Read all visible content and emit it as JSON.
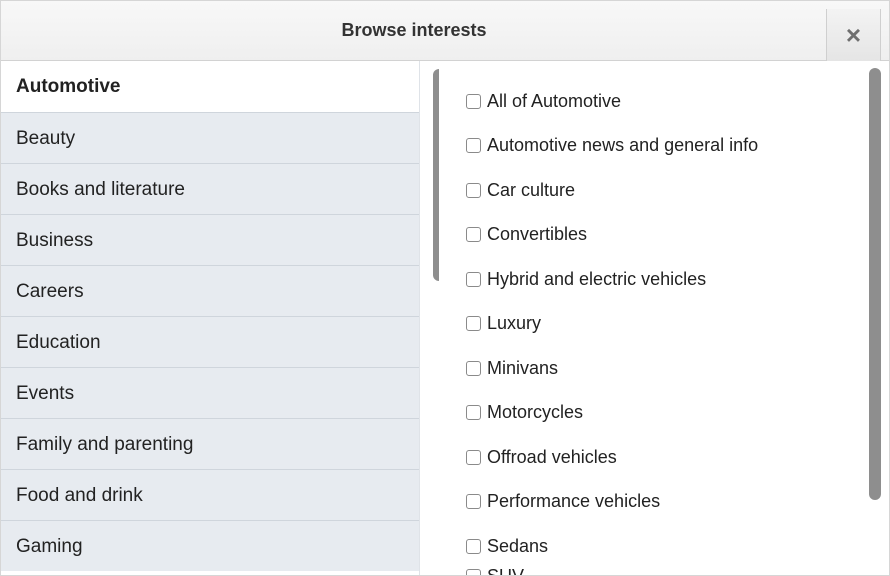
{
  "header": {
    "title": "Browse interests",
    "close_icon": "close-icon"
  },
  "categories": [
    {
      "label": "Automotive",
      "active": true
    },
    {
      "label": "Beauty",
      "active": false
    },
    {
      "label": "Books and literature",
      "active": false
    },
    {
      "label": "Business",
      "active": false
    },
    {
      "label": "Careers",
      "active": false
    },
    {
      "label": "Education",
      "active": false
    },
    {
      "label": "Events",
      "active": false
    },
    {
      "label": "Family and parenting",
      "active": false
    },
    {
      "label": "Food and drink",
      "active": false
    },
    {
      "label": "Gaming",
      "active": false
    }
  ],
  "options": [
    {
      "label": "All of Automotive",
      "checked": false
    },
    {
      "label": "Automotive news and general info",
      "checked": false
    },
    {
      "label": "Car culture",
      "checked": false
    },
    {
      "label": "Convertibles",
      "checked": false
    },
    {
      "label": "Hybrid and electric vehicles",
      "checked": false
    },
    {
      "label": "Luxury",
      "checked": false
    },
    {
      "label": "Minivans",
      "checked": false
    },
    {
      "label": "Motorcycles",
      "checked": false
    },
    {
      "label": "Offroad vehicles",
      "checked": false
    },
    {
      "label": "Performance vehicles",
      "checked": false
    },
    {
      "label": "Sedans",
      "checked": false
    },
    {
      "label": "SUV",
      "checked": false
    }
  ],
  "colors": {
    "header_bg": "#f3f3f3",
    "category_bg": "#e7ebf0",
    "active_bg": "#ffffff",
    "scrollbar": "#8e8e8e"
  }
}
